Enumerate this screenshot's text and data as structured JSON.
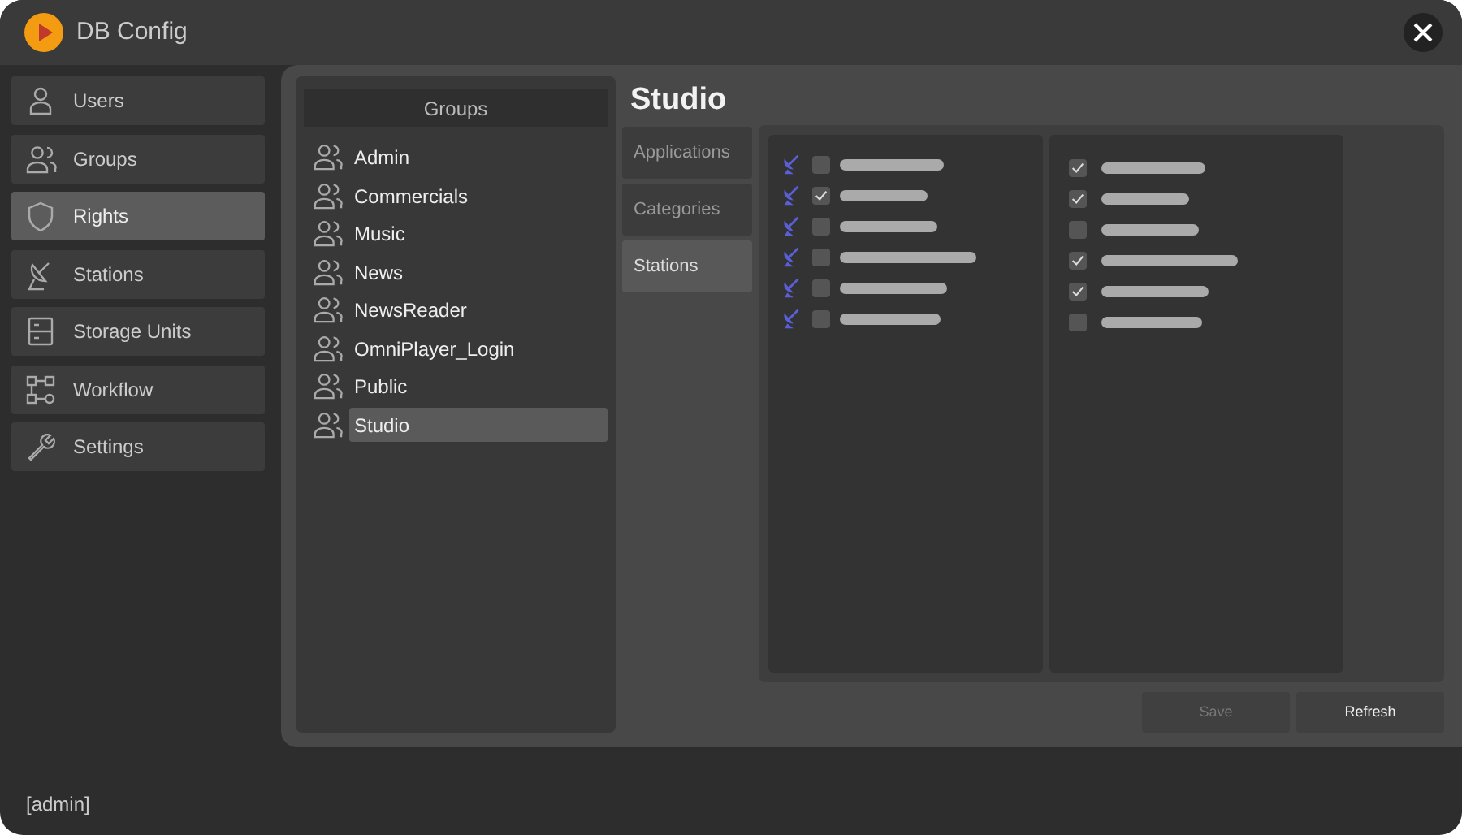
{
  "window": {
    "title": "DB Config"
  },
  "sidebar": {
    "items": [
      {
        "label": "Users",
        "selected": false
      },
      {
        "label": "Groups",
        "selected": false
      },
      {
        "label": "Rights",
        "selected": true
      },
      {
        "label": "Stations",
        "selected": false
      },
      {
        "label": "Storage Units",
        "selected": false
      },
      {
        "label": "Workflow",
        "selected": false
      },
      {
        "label": "Settings",
        "selected": false
      }
    ]
  },
  "groups": {
    "header": "Groups",
    "items": [
      {
        "label": "Admin",
        "selected": false
      },
      {
        "label": "Commercials",
        "selected": false
      },
      {
        "label": "Music",
        "selected": false
      },
      {
        "label": "News",
        "selected": false
      },
      {
        "label": "NewsReader",
        "selected": false
      },
      {
        "label": "OmniPlayer_Login",
        "selected": false
      },
      {
        "label": "Public",
        "selected": false
      },
      {
        "label": "Studio",
        "selected": true
      }
    ]
  },
  "detail": {
    "title": "Studio",
    "tabs": [
      {
        "label": "Applications",
        "selected": false
      },
      {
        "label": "Categories",
        "selected": false
      },
      {
        "label": "Stations",
        "selected": true
      }
    ],
    "stations": [
      {
        "checked": false
      },
      {
        "checked": true
      },
      {
        "checked": false
      },
      {
        "checked": false
      },
      {
        "checked": false
      },
      {
        "checked": false
      }
    ],
    "options": [
      {
        "checked": true
      },
      {
        "checked": true
      },
      {
        "checked": false
      },
      {
        "checked": true
      },
      {
        "checked": true
      },
      {
        "checked": false
      }
    ]
  },
  "buttons": [
    {
      "label": "Save",
      "disabled": true
    },
    {
      "label": "Refresh",
      "disabled": false
    }
  ],
  "status_bar": "[admin]"
}
